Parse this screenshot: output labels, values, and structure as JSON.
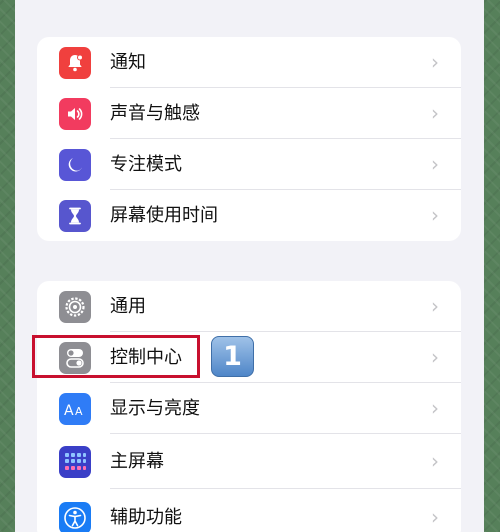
{
  "group1": {
    "items": [
      {
        "label": "通知",
        "icon": "bell-icon",
        "color": "#f0403e"
      },
      {
        "label": "声音与触感",
        "icon": "speaker-icon",
        "color": "#f23b5f"
      },
      {
        "label": "专注模式",
        "icon": "moon-icon",
        "color": "#5856d6"
      },
      {
        "label": "屏幕使用时间",
        "icon": "hourglass-icon",
        "color": "#5756ce"
      }
    ]
  },
  "group2": {
    "items": [
      {
        "label": "通用",
        "icon": "gear-icon",
        "color": "#8e8e93"
      },
      {
        "label": "控制中心",
        "icon": "toggles-icon",
        "color": "#8e8e93"
      },
      {
        "label": "显示与亮度",
        "icon": "aa-icon",
        "color": "#2f7cf6"
      },
      {
        "label": "主屏幕",
        "icon": "home-grid-icon",
        "color": "#3a3fc7"
      },
      {
        "label": "辅助功能",
        "icon": "accessibility-icon",
        "color": "#1a7cf5"
      }
    ]
  },
  "annotation": {
    "step_number": "1"
  },
  "chevron": "›"
}
